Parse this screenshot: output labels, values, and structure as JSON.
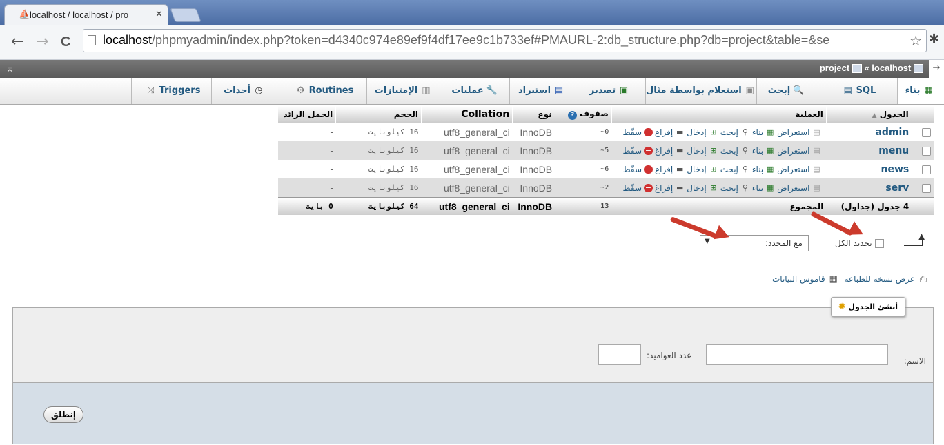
{
  "browser": {
    "tab_title": "localhost / localhost / pro",
    "tab_close": "×",
    "favicon": "PMA",
    "url_host": "localhost",
    "url_rest": "/phpmyadmin/index.php?token=d4340c974e89ef9f4df17ee9c1b733ef#PMAURL-2:db_structure.php?db=project&table=&se",
    "back": "←",
    "forward": "→",
    "reload": "C",
    "star": "☆"
  },
  "pma_bar": {
    "collapse": "⌅",
    "crumb_server": "localhost",
    "crumb_sep": "«",
    "crumb_db": "project",
    "arrow": "→"
  },
  "menu": {
    "structure": "بناء",
    "sql": "SQL",
    "search": "إبحث",
    "query": "استعلام بواسطة مثال",
    "export": "تصدير",
    "import": "استيراد",
    "operations": "عمليات",
    "privileges": "الإمتيازات",
    "routines": "Routines",
    "events": "أحداث",
    "triggers": "Triggers"
  },
  "table_headers": {
    "table": "الجدول",
    "sort": "▲",
    "action": "العملية",
    "rows": "صفوف",
    "help": "?",
    "type": "نوع",
    "collation": "Collation",
    "size": "الحجم",
    "overhead": "الحمل الزائد"
  },
  "actions": {
    "browse": "استعراض",
    "structure": "بناء",
    "search": "إبحث",
    "insert": "إدخال",
    "empty": "إفراغ",
    "drop": "سقّط"
  },
  "rows": [
    {
      "name": "admin",
      "rows": "0~",
      "type": "InnoDB",
      "collation": "utf8_general_ci",
      "size": "16 كيلوبايت",
      "overhead": "-"
    },
    {
      "name": "menu",
      "rows": "5~",
      "type": "InnoDB",
      "collation": "utf8_general_ci",
      "size": "16 كيلوبايت",
      "overhead": "-"
    },
    {
      "name": "news",
      "rows": "6~",
      "type": "InnoDB",
      "collation": "utf8_general_ci",
      "size": "16 كيلوبايت",
      "overhead": "-"
    },
    {
      "name": "serv",
      "rows": "2~",
      "type": "InnoDB",
      "collation": "utf8_general_ci",
      "size": "16 كيلوبايت",
      "overhead": "-"
    }
  ],
  "footer": {
    "count": "4 جدول (جداول)",
    "sum_label": "المجموع",
    "rows": "13",
    "type": "InnoDB",
    "collation": "utf8_general_ci",
    "size": "64 كيلوبايت",
    "overhead": "0 بايت"
  },
  "bulk": {
    "select_all": "تحديد الكل",
    "with_selected": "مع المحدد:",
    "dropdown": "▼"
  },
  "links": {
    "print": "عرض نسخة للطباعة",
    "dictionary": "قاموس البيانات"
  },
  "create": {
    "legend": "أنشئ الجدول",
    "name_label": "الاسم:",
    "columns_label": "عدد العواميد:",
    "name_value": "",
    "columns_value": "",
    "go": "إنطلق"
  },
  "colors": {
    "link": "#235a81",
    "annotation": "#cc3a2c"
  }
}
